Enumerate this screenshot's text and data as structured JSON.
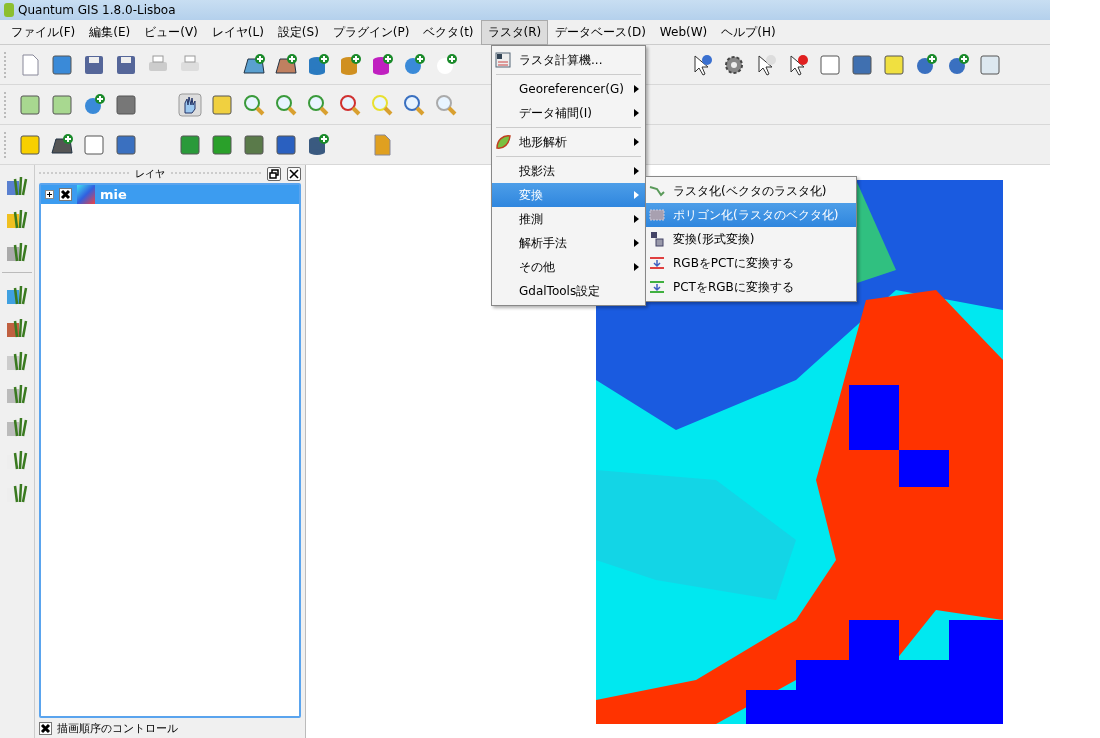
{
  "window": {
    "title": "Quantum GIS 1.8.0-Lisboa"
  },
  "menu_bar": [
    {
      "label": "ファイル(F)",
      "selected": false
    },
    {
      "label": "編集(E)",
      "selected": false
    },
    {
      "label": "ビュー(V)",
      "selected": false
    },
    {
      "label": "レイヤ(L)",
      "selected": false
    },
    {
      "label": "設定(S)",
      "selected": false
    },
    {
      "label": "プラグイン(P)",
      "selected": false
    },
    {
      "label": "ベクタ(t)",
      "selected": false
    },
    {
      "label": "ラスタ(R)",
      "selected": true
    },
    {
      "label": "データベース(D)",
      "selected": false
    },
    {
      "label": "Web(W)",
      "selected": false
    },
    {
      "label": "ヘルプ(H)",
      "selected": false
    }
  ],
  "raster_menu": [
    {
      "kind": "item",
      "label": "ラスタ計算機...",
      "has_icon": true,
      "submenu": false,
      "selected": false
    },
    {
      "kind": "separator"
    },
    {
      "kind": "item",
      "label": "Georeferencer(G)",
      "has_icon": false,
      "submenu": true,
      "selected": false
    },
    {
      "kind": "item",
      "label": "データ補間(I)",
      "has_icon": false,
      "submenu": true,
      "selected": false
    },
    {
      "kind": "separator"
    },
    {
      "kind": "item",
      "label": "地形解析",
      "has_icon": true,
      "submenu": true,
      "selected": false
    },
    {
      "kind": "separator"
    },
    {
      "kind": "item",
      "label": "投影法",
      "has_icon": false,
      "submenu": true,
      "selected": false
    },
    {
      "kind": "item",
      "label": "変換",
      "has_icon": false,
      "submenu": true,
      "selected": true
    },
    {
      "kind": "item",
      "label": "推測",
      "has_icon": false,
      "submenu": true,
      "selected": false
    },
    {
      "kind": "item",
      "label": "解析手法",
      "has_icon": false,
      "submenu": true,
      "selected": false
    },
    {
      "kind": "item",
      "label": "その他",
      "has_icon": false,
      "submenu": true,
      "selected": false
    },
    {
      "kind": "item",
      "label": "GdalTools設定",
      "has_icon": false,
      "submenu": false,
      "selected": false
    }
  ],
  "conversion_submenu": [
    {
      "label": "ラスタ化(ベクタのラスタ化)",
      "selected": false
    },
    {
      "label": "ポリゴン化(ラスタのベクタ化)",
      "selected": true
    },
    {
      "label": "変換(形式変換)",
      "selected": false
    },
    {
      "label": "RGBをPCTに変換する",
      "selected": false
    },
    {
      "label": "PCTをRGBに変換する",
      "selected": false
    }
  ],
  "layers_panel": {
    "title": "レイヤ",
    "layers": [
      {
        "name": "mie",
        "visible": true,
        "expanded": false,
        "selected": true
      }
    ],
    "render_order": {
      "label": "描画順序のコントロール",
      "checked": true
    }
  }
}
